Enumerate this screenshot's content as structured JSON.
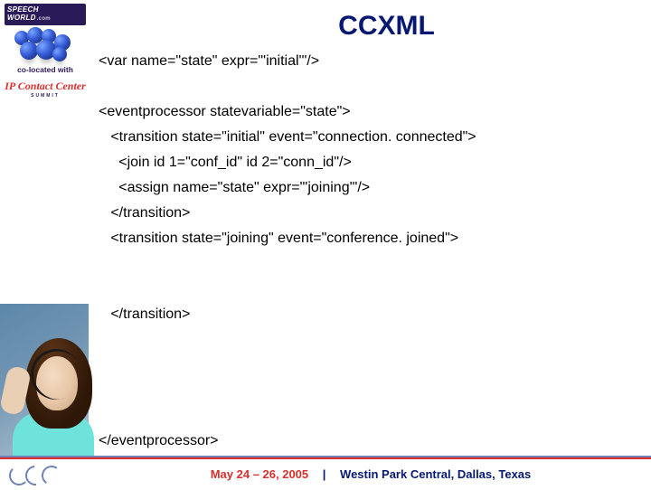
{
  "sidebar": {
    "logo_text": "SPEECH WORLD",
    "logo_suffix": ".com",
    "colocated": "co-located with",
    "cc_brand": "IP Contact Center",
    "cc_sub": "SUMMIT"
  },
  "title": "CCXML",
  "code": "<var name=\"state\" expr=\"'initial'\"/>\n\n<eventprocessor statevariable=\"state\">\n   <transition state=\"initial\" event=\"connection. connected\">\n     <join id 1=\"conf_id\" id 2=\"conn_id\"/>\n     <assign name=\"state\" expr=\"'joining'\"/>\n   </transition>\n   <transition state=\"joining\" event=\"conference. joined\">\n\n\n   </transition>\n\n\n\n\n</eventprocessor>",
  "footer": {
    "dates": "May 24 – 26, 2005",
    "pipe": "|",
    "venue": "Westin Park Central, Dallas, Texas"
  }
}
